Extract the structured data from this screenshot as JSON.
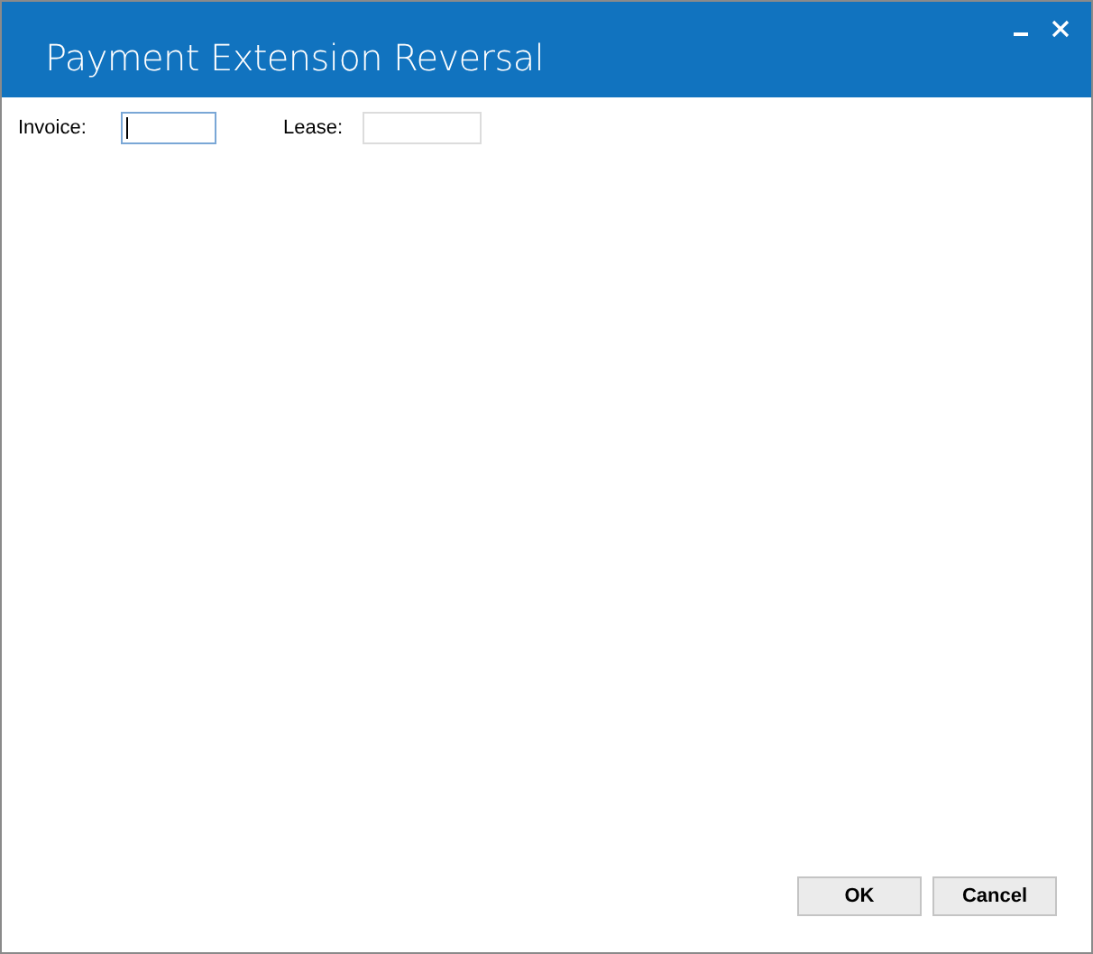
{
  "window": {
    "title": "Payment Extension Reversal"
  },
  "fields": [
    {
      "label": "Invoice:",
      "focused": true
    },
    {
      "label": "Lease:",
      "focused": false
    }
  ],
  "buttons": [
    "OK",
    "Cancel"
  ]
}
